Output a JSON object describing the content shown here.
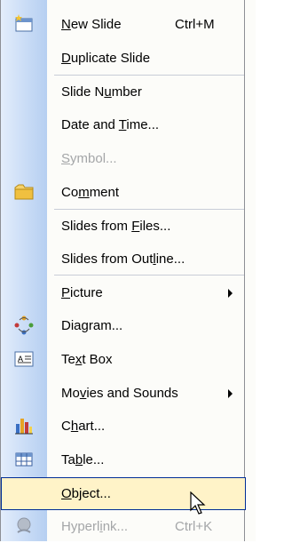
{
  "menu": {
    "items": [
      {
        "label": "New Slide",
        "u": "N",
        "shortcut": "Ctrl+M",
        "icon": "new-slide-icon",
        "enabled": true
      },
      {
        "label": "Duplicate Slide",
        "u": "D",
        "shortcut": "",
        "icon": "",
        "enabled": true
      },
      {
        "label": "Slide Number",
        "u": "u",
        "shortcut": "",
        "icon": "",
        "enabled": true
      },
      {
        "label": "Date and Time...",
        "u": "T",
        "shortcut": "",
        "icon": "",
        "enabled": true
      },
      {
        "label": "Symbol...",
        "u": "S",
        "shortcut": "",
        "icon": "",
        "enabled": false
      },
      {
        "label": "Comment",
        "u": "m",
        "shortcut": "",
        "icon": "comment-icon",
        "enabled": true
      },
      {
        "label": "Slides from Files...",
        "u": "F",
        "shortcut": "",
        "icon": "",
        "enabled": true
      },
      {
        "label": "Slides from Outline...",
        "u": "l",
        "shortcut": "",
        "icon": "",
        "enabled": true
      },
      {
        "label": "Picture",
        "u": "P",
        "shortcut": "",
        "icon": "",
        "enabled": true,
        "submenu": true
      },
      {
        "label": "Diagram...",
        "u": "G",
        "shortcut": "",
        "icon": "diagram-icon",
        "enabled": true
      },
      {
        "label": "Text Box",
        "u": "x",
        "shortcut": "",
        "icon": "text-box-icon",
        "enabled": true
      },
      {
        "label": "Movies and Sounds",
        "u": "v",
        "shortcut": "",
        "icon": "",
        "enabled": true,
        "submenu": true
      },
      {
        "label": "Chart...",
        "u": "h",
        "shortcut": "",
        "icon": "chart-icon",
        "enabled": true
      },
      {
        "label": "Table...",
        "u": "b",
        "shortcut": "",
        "icon": "table-icon",
        "enabled": true
      },
      {
        "label": "Object...",
        "u": "O",
        "shortcut": "",
        "icon": "",
        "enabled": true,
        "highlighted": true
      },
      {
        "label": "Hyperlink...",
        "u": "i",
        "shortcut": "Ctrl+K",
        "icon": "hyperlink-icon",
        "enabled": false
      }
    ]
  },
  "colors": {
    "highlight_bg": "#fff3c8",
    "highlight_border": "#002d96",
    "gutter": "#c9dcf6",
    "disabled_text": "#a4a6a8"
  }
}
